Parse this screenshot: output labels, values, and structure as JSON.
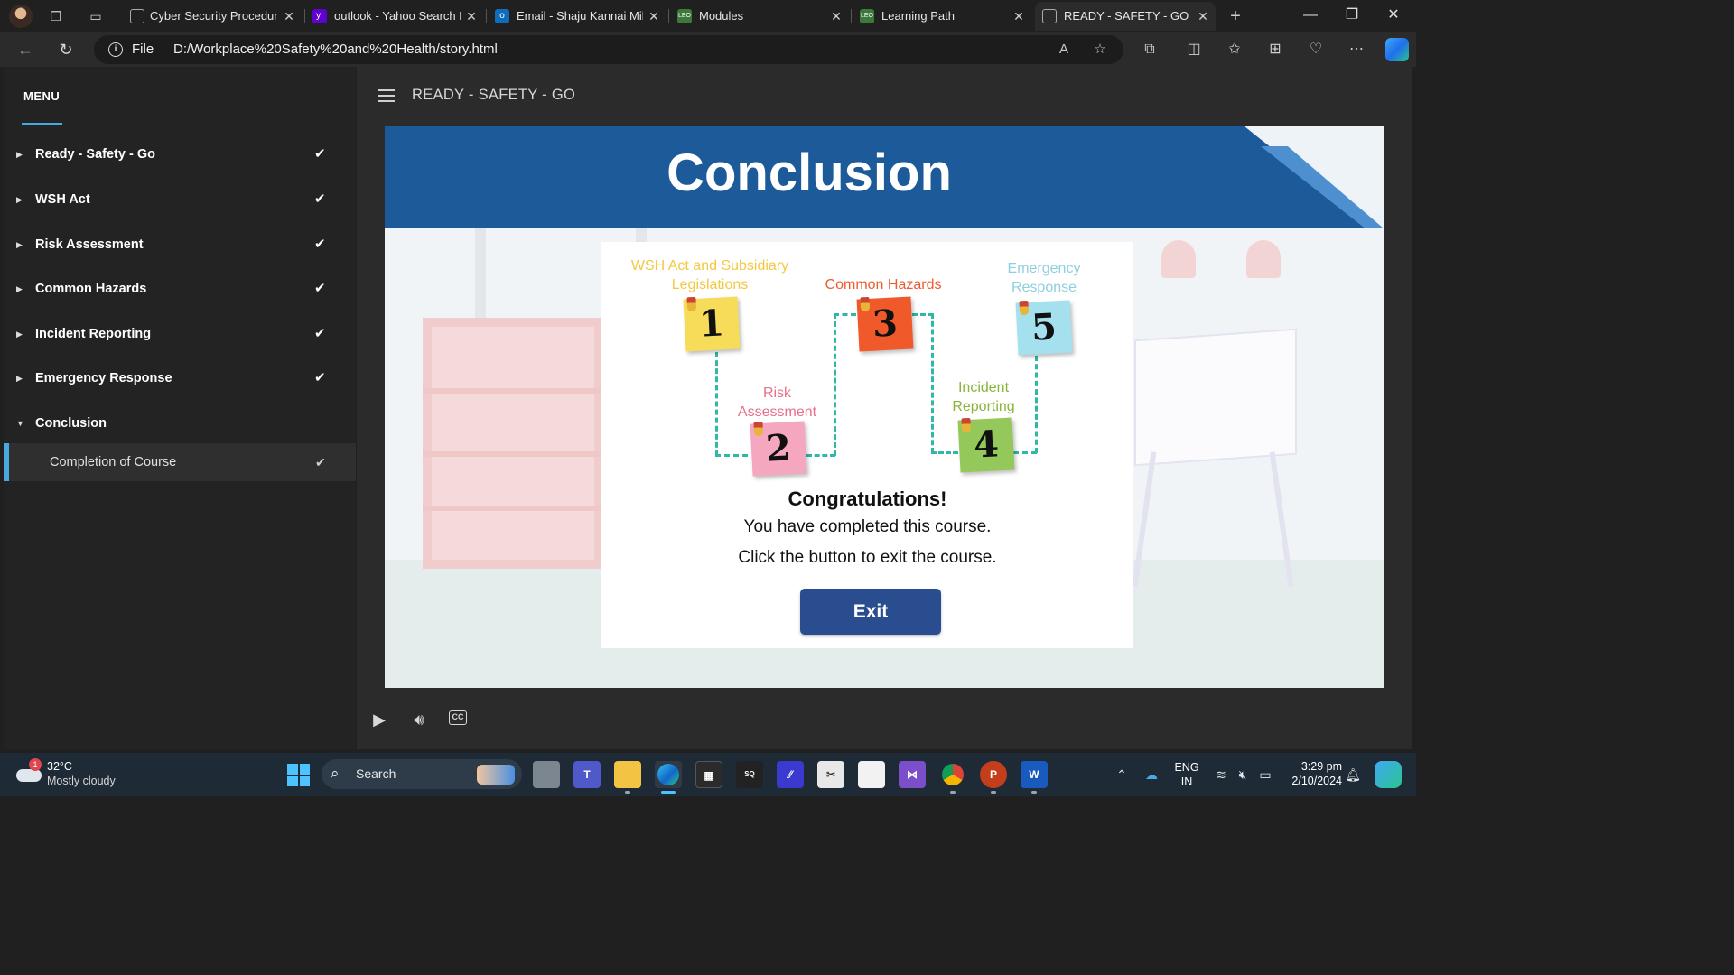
{
  "browser": {
    "tabs": [
      {
        "label": "Cyber Security Procedure",
        "favicon": "page-icon",
        "active": false
      },
      {
        "label": "outlook - Yahoo Search Re",
        "favicon": "yahoo-icon",
        "active": false
      },
      {
        "label": "Email - Shaju Kannai Milan",
        "favicon": "outlook-icon",
        "active": false
      },
      {
        "label": "Modules",
        "favicon": "leo-icon",
        "active": false
      },
      {
        "label": "Learning Path",
        "favicon": "leo-icon",
        "active": false
      },
      {
        "label": "READY - SAFETY - GO",
        "favicon": "page-icon",
        "active": true
      }
    ],
    "address": {
      "scheme_label": "File",
      "url": "D:/Workplace%20Safety%20and%20Health/story.html"
    }
  },
  "sidebar": {
    "title": "MENU",
    "items": [
      {
        "label": "Ready - Safety - Go",
        "completed": true
      },
      {
        "label": "WSH Act",
        "completed": true
      },
      {
        "label": "Risk Assessment",
        "completed": true
      },
      {
        "label": "Common Hazards",
        "completed": true
      },
      {
        "label": "Incident Reporting",
        "completed": true
      },
      {
        "label": "Emergency Response",
        "completed": true
      },
      {
        "label": "Conclusion",
        "completed": false,
        "expanded": true
      }
    ],
    "sub_items": [
      {
        "label": "Completion of Course",
        "completed": true,
        "selected": true
      }
    ]
  },
  "player": {
    "course_title": "READY - SAFETY - GO",
    "slide": {
      "title": "Conclusion",
      "steps": [
        {
          "number": "1",
          "label": "WSH Act and Subsidiary Legislations",
          "label_color": "#f5c842",
          "note_color": "#f7dc5a"
        },
        {
          "number": "2",
          "label": "Risk Assessment",
          "label_color": "#e8708a",
          "note_color": "#f5a7c0"
        },
        {
          "number": "3",
          "label": "Common Hazards",
          "label_color": "#ee5a2f",
          "note_color": "#f05a2a"
        },
        {
          "number": "4",
          "label": "Incident Reporting",
          "label_color": "#8bb43a",
          "note_color": "#95c85a"
        },
        {
          "number": "5",
          "label": "Emergency Response",
          "label_color": "#8fd0e0",
          "note_color": "#a4e0ee"
        }
      ],
      "congrats": "Congratulations!",
      "line1": "You have completed this course.",
      "line2": "Click the button to exit the course.",
      "exit_label": "Exit"
    },
    "controls": [
      "play-icon",
      "volume-icon",
      "closed-captions-icon"
    ],
    "cc_label": "CC"
  },
  "taskbar": {
    "weather": {
      "temp": "32°C",
      "condition": "Mostly cloudy",
      "badge": "1"
    },
    "search_label": "Search",
    "language": {
      "line1": "ENG",
      "line2": "IN"
    },
    "clock": {
      "time": "3:29 pm",
      "date": "2/10/2024"
    }
  }
}
